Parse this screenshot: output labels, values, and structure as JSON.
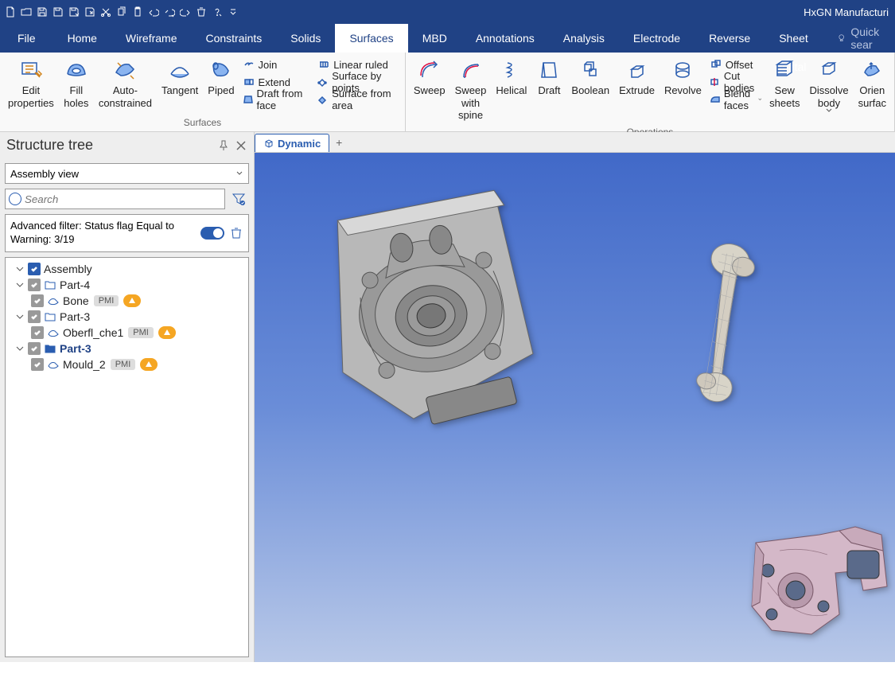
{
  "app": {
    "title": "HxGN Manufacturi"
  },
  "qat_icons": [
    "new",
    "open",
    "save-assembly",
    "save",
    "save-as",
    "export",
    "cut",
    "copy",
    "paste",
    "undo",
    "undo-history",
    "redo",
    "delete",
    "help",
    "dropdown"
  ],
  "menubar": {
    "tabs": [
      "File",
      "Home",
      "Wireframe",
      "Constraints",
      "Solids",
      "Surfaces",
      "MBD",
      "Annotations",
      "Analysis",
      "Electrode",
      "Reverse",
      "Sheet metal"
    ],
    "active": "Surfaces",
    "quick_search_placeholder": "Quick sear"
  },
  "ribbon": {
    "group_surfaces_label": "Surfaces",
    "group_operations_label": "Operations",
    "edit_properties": "Edit\nproperties",
    "fill_holes": "Fill\nholes",
    "auto_constrained": "Auto-\nconstrained",
    "tangent": "Tangent",
    "piped": "Piped",
    "join": "Join",
    "extend": "Extend",
    "draft_from_face": "Draft from face",
    "linear_ruled": "Linear ruled",
    "surface_by_points": "Surface by points",
    "surface_from_area": "Surface from area",
    "sweep": "Sweep",
    "sweep_with_spine": "Sweep\nwith spine",
    "helical": "Helical",
    "draft": "Draft",
    "boolean": "Boolean",
    "extrude": "Extrude",
    "revolve": "Revolve",
    "offset": "Offset",
    "cut_bodies": "Cut bodies",
    "blend_faces": "Blend faces",
    "sew_sheets": "Sew\nsheets",
    "dissolve_body": "Dissolve\nbody",
    "orient_surfaces": "Orien\nsurfac"
  },
  "tree": {
    "title": "Structure tree",
    "view_selector": "Assembly view",
    "search_placeholder": "Search",
    "filter_text": "Advanced filter: Status flag Equal to Warning: 3/19",
    "root": "Assembly",
    "nodes": [
      {
        "label": "Part-4",
        "children": [
          {
            "label": "Bone",
            "pmi": "PMI"
          }
        ]
      },
      {
        "label": "Part-3",
        "children": [
          {
            "label": "Oberfl_che1",
            "pmi": "PMI"
          }
        ]
      },
      {
        "label": "Part-3",
        "bold": true,
        "children": [
          {
            "label": "Mould_2",
            "pmi": "PMI"
          }
        ]
      }
    ]
  },
  "viewport": {
    "active_tab": "Dynamic",
    "add_tab": "+"
  }
}
